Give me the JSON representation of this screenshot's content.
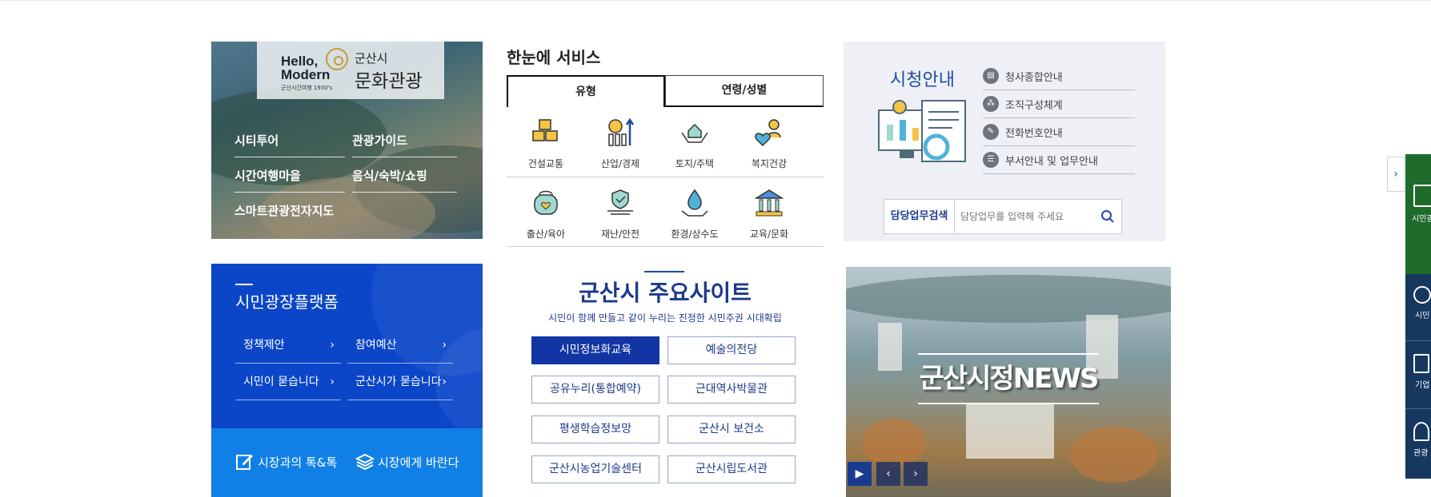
{
  "tourism": {
    "logo_hello": "Hello,",
    "logo_modern": "Modern",
    "logo_sub": "군산시간여행 1930's",
    "logo_city": "군산시",
    "logo_culture": "문화관광",
    "links": [
      "시티투어",
      "관광가이드",
      "시간여행마을",
      "음식/숙박/쇼핑",
      "스마트관광전자지도"
    ]
  },
  "service": {
    "title": "한눈에 서비스",
    "tabs": [
      "유형",
      "연령/성별"
    ],
    "items": [
      {
        "label": "건설교통",
        "icon": "boxes-icon"
      },
      {
        "label": "산업/경제",
        "icon": "chart-growth-icon"
      },
      {
        "label": "토지/주택",
        "icon": "house-hands-icon"
      },
      {
        "label": "복지건강",
        "icon": "care-heart-icon"
      },
      {
        "label": "출산/육아",
        "icon": "baby-bag-icon"
      },
      {
        "label": "재난/안전",
        "icon": "safety-check-icon"
      },
      {
        "label": "환경/상수도",
        "icon": "water-drop-icon"
      },
      {
        "label": "교육/문화",
        "icon": "institution-icon"
      }
    ]
  },
  "city_hall": {
    "title": "시청안내",
    "links": [
      "청사종합안내",
      "조직구성체계",
      "전화번호안내",
      "부서안내 및 업무안내"
    ],
    "search_label": "담당업무검색",
    "search_placeholder": "담당업무를 입력해 주세요"
  },
  "plaza": {
    "title": "시민광장플랫폼",
    "links": [
      "정책제안",
      "참여예산",
      "시민이 묻습니다",
      "군산시가 묻습니다"
    ],
    "bottom": [
      "시장과의 톡&톡",
      "시장에게 바란다"
    ]
  },
  "sites": {
    "title": "군산시 주요사이트",
    "subtitle": "시민이 함께 만들고 같이 누리는 진정한 시민주권 시대확립",
    "buttons": [
      "시민정보화교육",
      "예술의전당",
      "공유누리(통합예약)",
      "근대역사박물관",
      "평생학습정보망",
      "군산시 보건소",
      "군산시농업기술센터",
      "군산시립도서관"
    ]
  },
  "news": {
    "logo": "군산시정NEWS",
    "controls": [
      "▶",
      "‹",
      "›"
    ]
  },
  "quick_menu": {
    "toggle": "›",
    "items": [
      "시민광장 플랫폼",
      "시민",
      "기업",
      "관광"
    ]
  },
  "colors": {
    "primary_blue": "#0b46c8",
    "navy": "#1c3a8a",
    "green": "#1e6b2c",
    "light_blue": "#1180e6"
  }
}
